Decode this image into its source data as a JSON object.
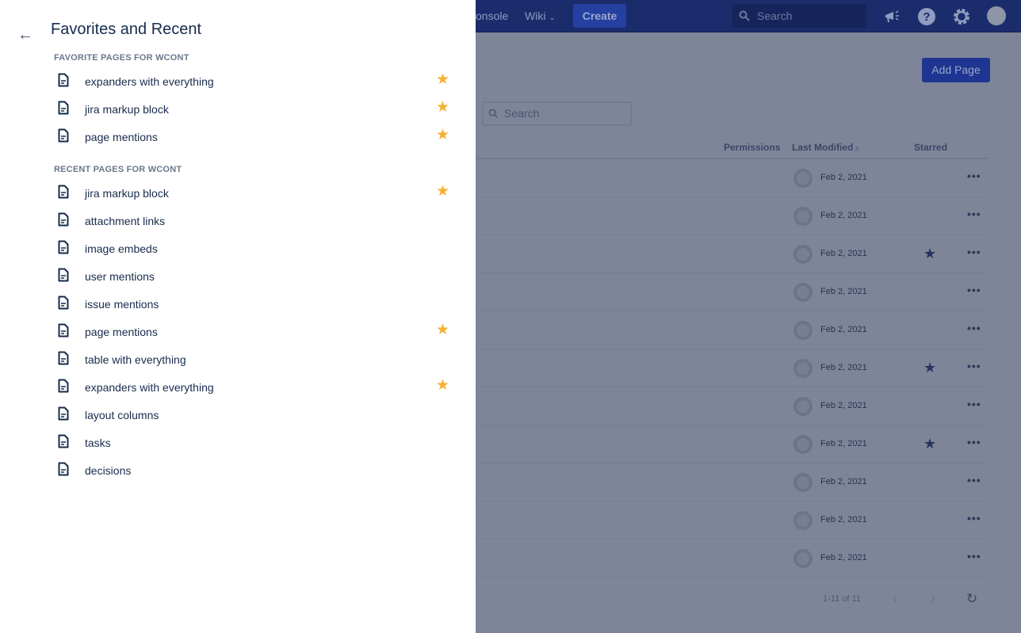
{
  "header": {
    "nav_partial": "onsole",
    "wiki": "Wiki",
    "create": "Create",
    "search_placeholder": "Search",
    "icons": [
      "megaphone-icon",
      "help-icon",
      "gear-icon",
      "avatar"
    ]
  },
  "content": {
    "add_page": "Add Page",
    "search_placeholder": "Search",
    "columns": [
      "Permissions",
      "Last Modified",
      "Starred"
    ],
    "rows": [
      {
        "date": "Feb 2, 2021",
        "starred": false
      },
      {
        "date": "Feb 2, 2021",
        "starred": false
      },
      {
        "date": "Feb 2, 2021",
        "starred": true
      },
      {
        "date": "Feb 2, 2021",
        "starred": false
      },
      {
        "date": "Feb 2, 2021",
        "starred": false
      },
      {
        "date": "Feb 2, 2021",
        "starred": true
      },
      {
        "date": "Feb 2, 2021",
        "starred": false
      },
      {
        "date": "Feb 2, 2021",
        "starred": true
      },
      {
        "date": "Feb 2, 2021",
        "starred": false
      },
      {
        "date": "Feb 2, 2021",
        "starred": false
      },
      {
        "date": "Feb 2, 2021",
        "starred": false
      }
    ],
    "pager": "1-11 of 11"
  },
  "panel": {
    "title": "Favorites and Recent",
    "favorites_heading": "FAVORITE PAGES FOR WCONT",
    "recent_heading": "RECENT PAGES FOR WCONT",
    "favorites": [
      {
        "label": "expanders with everything",
        "starred": true
      },
      {
        "label": "jira markup block",
        "starred": true
      },
      {
        "label": "page mentions",
        "starred": true
      }
    ],
    "recent": [
      {
        "label": "jira markup block",
        "starred": true
      },
      {
        "label": "attachment links",
        "starred": false
      },
      {
        "label": "image embeds",
        "starred": false
      },
      {
        "label": "user mentions",
        "starred": false
      },
      {
        "label": "issue mentions",
        "starred": false
      },
      {
        "label": "page mentions",
        "starred": true
      },
      {
        "label": "table with everything",
        "starred": false
      },
      {
        "label": "expanders with everything",
        "starred": true
      },
      {
        "label": "layout columns",
        "starred": false
      },
      {
        "label": "tasks",
        "starred": false
      },
      {
        "label": "decisions",
        "starred": false
      }
    ]
  },
  "colors": {
    "star": "#f6b12f",
    "header": "#1a2c6c",
    "overlay": "#7f8599"
  }
}
